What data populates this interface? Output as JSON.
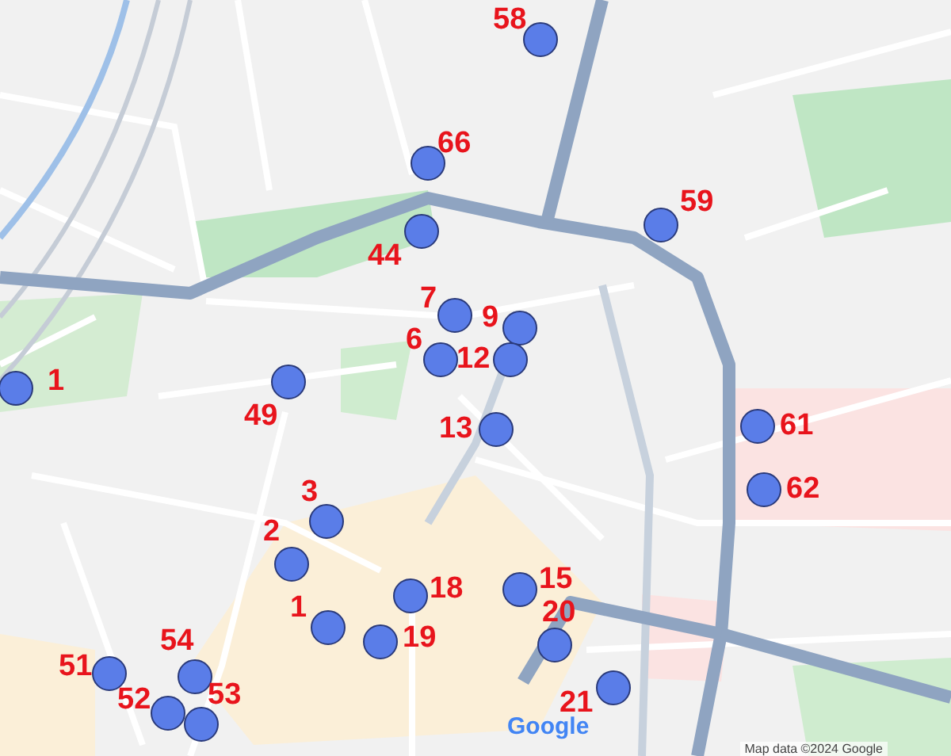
{
  "markers": [
    {
      "label": "58"
    },
    {
      "label": "66"
    },
    {
      "label": "59"
    },
    {
      "label": "44"
    },
    {
      "label": "7"
    },
    {
      "label": "9"
    },
    {
      "label": "6"
    },
    {
      "label": "12"
    },
    {
      "label": "13"
    },
    {
      "label": "49"
    },
    {
      "label": "1"
    },
    {
      "label": "61"
    },
    {
      "label": "62"
    },
    {
      "label": "3"
    },
    {
      "label": "2"
    },
    {
      "label": "18"
    },
    {
      "label": "15"
    },
    {
      "label": "1"
    },
    {
      "label": "19"
    },
    {
      "label": "20"
    },
    {
      "label": "21"
    },
    {
      "label": "51"
    },
    {
      "label": "54"
    },
    {
      "label": "52"
    },
    {
      "label": "53"
    }
  ],
  "map": {
    "logo": "Google",
    "attribution": "Map data ©2024 Google"
  }
}
